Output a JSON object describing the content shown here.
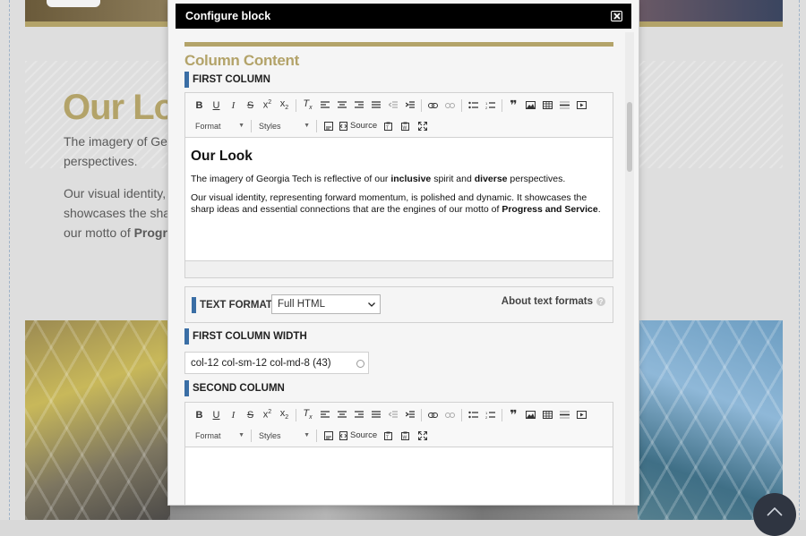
{
  "background": {
    "heading": "Our Loo",
    "lines": [
      {
        "text": "The imagery of Geo"
      },
      {
        "text": "perspectives."
      },
      {
        "text": "Our visual identity, r"
      },
      {
        "text": "showcases the sha"
      },
      {
        "prefix": "our motto of ",
        "bold": "Progre"
      }
    ]
  },
  "modal": {
    "title": "Configure block",
    "section_title": "Column Content",
    "first_column": {
      "label": "FIRST COLUMN",
      "toolbar": {
        "format_label": "Format",
        "styles_label": "Styles",
        "source_label": "Source"
      },
      "content": {
        "heading": "Our Look",
        "p1": {
          "a": "The imagery of Georgia Tech is reflective of our ",
          "b1": "inclusive",
          "c": " spirit and ",
          "b2": "diverse",
          "d": " perspectives."
        },
        "p2": {
          "a": "Our visual identity, representing forward momentum, is polished and dynamic. It showcases the sharp ideas and essential connections that are the engines of our motto of ",
          "b": "Progress and Service",
          "c": "."
        }
      }
    },
    "text_format": {
      "label": "TEXT FORMAT",
      "selected": "Full HTML",
      "about_label": "About text formats",
      "help_glyph": "?"
    },
    "first_column_width": {
      "label": "FIRST COLUMN WIDTH",
      "value": "col-12 col-sm-12 col-md-8 (43)"
    },
    "second_column": {
      "label": "SECOND COLUMN",
      "toolbar": {
        "format_label": "Format",
        "styles_label": "Styles",
        "source_label": "Source"
      }
    }
  },
  "colors": {
    "gold": "#b3a369",
    "label_bar": "#3a6ea5",
    "header": "#000000"
  }
}
